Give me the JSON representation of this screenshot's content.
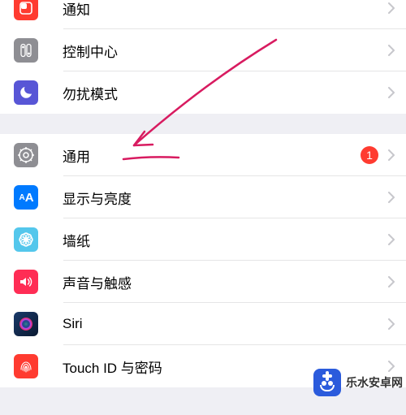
{
  "groups": [
    {
      "items": [
        {
          "key": "notifications",
          "label": "通知",
          "icon": "notifications-icon",
          "icon_bg": "#ff3b30"
        },
        {
          "key": "control-center",
          "label": "控制中心",
          "icon": "control-center-icon",
          "icon_bg": "#8e8e93"
        },
        {
          "key": "dnd",
          "label": "勿扰模式",
          "icon": "do-not-disturb-icon",
          "icon_bg": "#5856d6"
        }
      ]
    },
    {
      "items": [
        {
          "key": "general",
          "label": "通用",
          "icon": "general-icon",
          "icon_bg": "#8e8e93",
          "badge": "1"
        },
        {
          "key": "display",
          "label": "显示与亮度",
          "icon": "display-brightness-icon",
          "icon_bg": "#007aff"
        },
        {
          "key": "wallpaper",
          "label": "墙纸",
          "icon": "wallpaper-icon",
          "icon_bg": "#54c7ec"
        },
        {
          "key": "sound",
          "label": "声音与触感",
          "icon": "sounds-haptics-icon",
          "icon_bg": "#ff2d55"
        },
        {
          "key": "siri",
          "label": "Siri",
          "icon": "siri-icon",
          "icon_bg": "#000"
        },
        {
          "key": "touchid",
          "label": "Touch ID 与密码",
          "icon": "touch-id-icon",
          "icon_bg": "#ff3b30"
        }
      ]
    }
  ],
  "colors": {
    "badge_bg": "#ff3b30",
    "separator": "#efeff4",
    "chevron": "#c7c7cc",
    "annotation": "#d81b60"
  },
  "watermark": {
    "text": "乐水安卓网"
  }
}
